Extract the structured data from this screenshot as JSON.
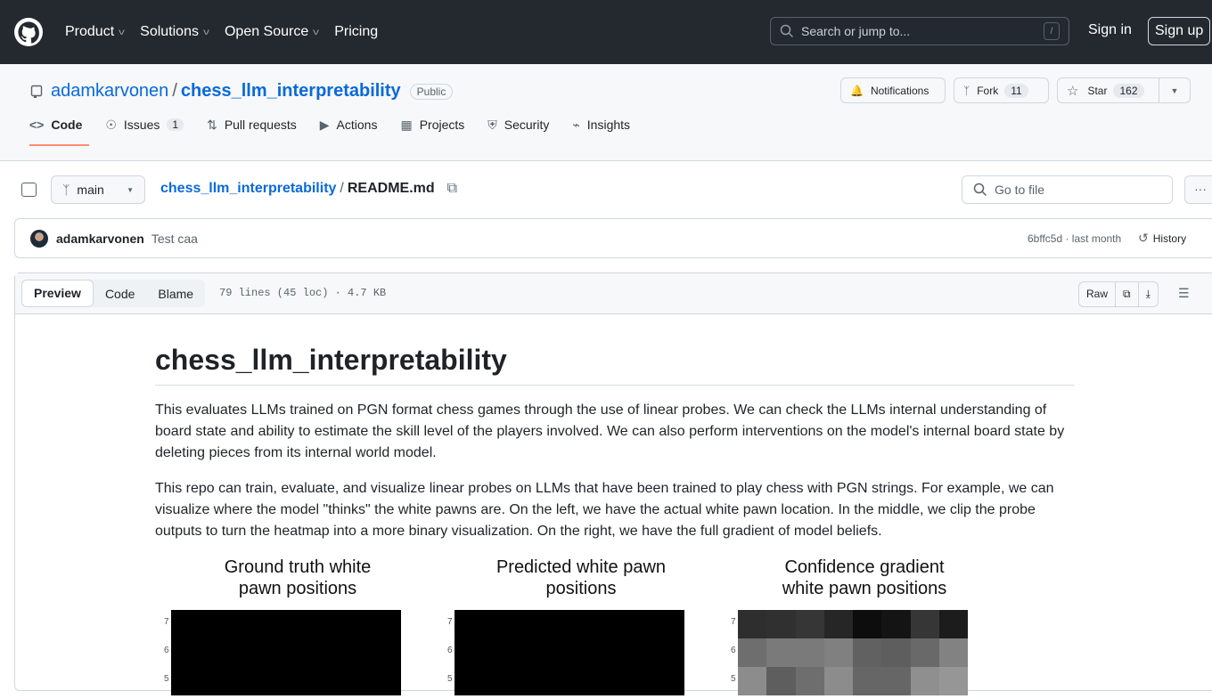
{
  "topnav": {
    "items": [
      {
        "label": "Product",
        "dropdown": true
      },
      {
        "label": "Solutions",
        "dropdown": true
      },
      {
        "label": "Open Source",
        "dropdown": true
      },
      {
        "label": "Pricing",
        "dropdown": false
      }
    ],
    "search_placeholder": "Search or jump to...",
    "search_shortcut": "/",
    "sign_in": "Sign in",
    "sign_up": "Sign up"
  },
  "repo": {
    "owner": "adamkarvonen",
    "separator": "/",
    "name": "chess_llm_interpretability",
    "visibility": "Public",
    "notifications_label": "Notifications",
    "fork_label": "Fork",
    "fork_count": "11",
    "star_label": "Star",
    "star_count": "162"
  },
  "tabs": [
    {
      "label": "Code",
      "icon": "code-icon",
      "active": true
    },
    {
      "label": "Issues",
      "icon": "issue-icon",
      "count": "1"
    },
    {
      "label": "Pull requests",
      "icon": "pull-request-icon"
    },
    {
      "label": "Actions",
      "icon": "play-icon"
    },
    {
      "label": "Projects",
      "icon": "table-icon"
    },
    {
      "label": "Security",
      "icon": "shield-icon"
    },
    {
      "label": "Insights",
      "icon": "graph-icon"
    }
  ],
  "filebar": {
    "branch": "main",
    "breadcrumb_repo": "chess_llm_interpretability",
    "breadcrumb_sep": "/",
    "filename": "README.md",
    "goto_placeholder": "Go to file",
    "more": "···"
  },
  "commit": {
    "author": "adamkarvonen",
    "message": "Test caa",
    "hash_time": "6bffc5d · last month",
    "history_label": "History"
  },
  "fileview": {
    "tabs": [
      "Preview",
      "Code",
      "Blame"
    ],
    "active_tab": "Preview",
    "info": "79 lines (45 loc) · 4.7 KB",
    "raw": "Raw"
  },
  "readme": {
    "title": "chess_llm_interpretability",
    "p1": "This evaluates LLMs trained on PGN format chess games through the use of linear probes. We can check the LLMs internal understanding of board state and ability to estimate the skill level of the players involved. We can also perform interventions on the model's internal board state by deleting pieces from its internal world model.",
    "p2": "This repo can train, evaluate, and visualize linear probes on LLMs that have been trained to play chess with PGN strings. For example, we can visualize where the model \"thinks\" the white pawns are. On the left, we have the actual white pawn location. In the middle, we clip the probe outputs to turn the heatmap into a more binary visualization. On the right, we have the full gradient of model beliefs.",
    "figures": [
      {
        "title_l1": "Ground truth white",
        "title_l2": "pawn positions",
        "rows": [
          "7",
          "6",
          "5"
        ],
        "cells": [
          [
            0,
            0,
            0,
            0,
            0,
            0,
            0,
            0
          ],
          [
            0,
            0,
            0,
            0,
            0,
            0,
            0,
            0
          ],
          [
            0,
            0,
            0,
            0,
            0,
            0,
            0,
            0
          ]
        ]
      },
      {
        "title_l1": "Predicted white pawn",
        "title_l2": "positions",
        "rows": [
          "7",
          "6",
          "5"
        ],
        "cells": [
          [
            0,
            0,
            0,
            0,
            0,
            0,
            0,
            0
          ],
          [
            0,
            0,
            0,
            0,
            0,
            0,
            0,
            0
          ],
          [
            0,
            0,
            0,
            0,
            0,
            0,
            0,
            0
          ]
        ]
      },
      {
        "title_l1": "Confidence gradient",
        "title_l2": "white pawn positions",
        "rows": [
          "7",
          "6",
          "5"
        ],
        "cells": [
          [
            0.18,
            0.19,
            0.21,
            0.15,
            0.05,
            0.08,
            0.21,
            0.11
          ],
          [
            0.43,
            0.48,
            0.48,
            0.5,
            0.38,
            0.37,
            0.41,
            0.51
          ],
          [
            0.55,
            0.37,
            0.43,
            0.55,
            0.4,
            0.4,
            0.56,
            0.59
          ]
        ]
      }
    ]
  }
}
